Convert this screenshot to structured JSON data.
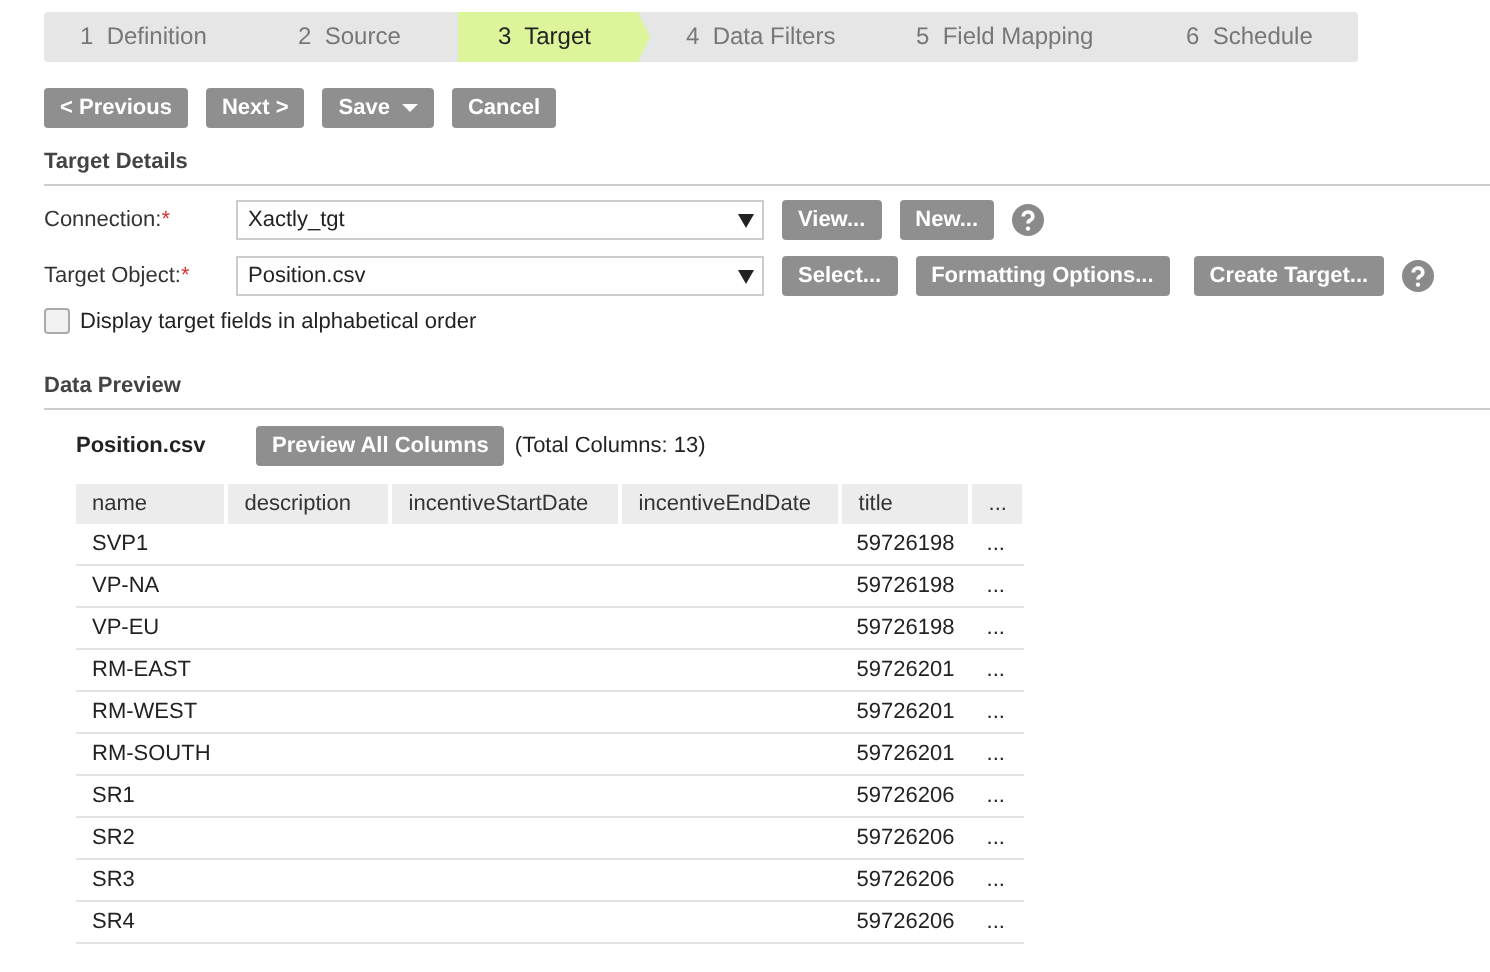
{
  "steps": [
    {
      "number": "1",
      "label": "Definition",
      "selected": false
    },
    {
      "number": "2",
      "label": "Source",
      "selected": false
    },
    {
      "number": "3",
      "label": "Target",
      "selected": true
    },
    {
      "number": "4",
      "label": "Data Filters",
      "selected": false
    },
    {
      "number": "5",
      "label": "Field Mapping",
      "selected": false
    },
    {
      "number": "6",
      "label": "Schedule",
      "selected": false
    }
  ],
  "nav_buttons": [
    {
      "label": "< Previous",
      "caret": false
    },
    {
      "label": "Next >",
      "caret": false
    },
    {
      "label": "Save",
      "caret": true
    },
    {
      "label": "Cancel",
      "caret": false
    }
  ],
  "target_details": {
    "heading": "Target Details",
    "fields": [
      {
        "label": "Connection:",
        "required_mark": "*",
        "value": "Xactly_tgt",
        "buttons": [
          "View...",
          "New..."
        ],
        "help": true
      },
      {
        "label": "Target Object:",
        "required_mark": "*",
        "value": "Position.csv",
        "buttons": [
          "Select...",
          "Formatting Options...",
          "Create Target..."
        ],
        "help": true
      }
    ],
    "checkbox": {
      "label": "Display target fields in alphabetical order",
      "checked": false
    }
  },
  "data_preview": {
    "heading": "Data Preview",
    "object_name": "Position.csv",
    "preview_button": "Preview All Columns",
    "total_columns": "(Total Columns: 13)",
    "table": {
      "columns": [
        "name",
        "description",
        "incentiveStartDate",
        "incentiveEndDate",
        "title",
        "..."
      ],
      "rows": [
        [
          "SVP1",
          "",
          "",
          "",
          "59726198",
          "..."
        ],
        [
          "VP-NA",
          "",
          "",
          "",
          "59726198",
          "..."
        ],
        [
          "VP-EU",
          "",
          "",
          "",
          "59726198",
          "..."
        ],
        [
          "RM-EAST",
          "",
          "",
          "",
          "59726201",
          "..."
        ],
        [
          "RM-WEST",
          "",
          "",
          "",
          "59726201",
          "..."
        ],
        [
          "RM-SOUTH",
          "",
          "",
          "",
          "59726201",
          "..."
        ],
        [
          "SR1",
          "",
          "",
          "",
          "59726206",
          "..."
        ],
        [
          "SR2",
          "",
          "",
          "",
          "59726206",
          "..."
        ],
        [
          "SR3",
          "",
          "",
          "",
          "59726206",
          "..."
        ],
        [
          "SR4",
          "",
          "",
          "",
          "59726206",
          "..."
        ]
      ]
    }
  }
}
